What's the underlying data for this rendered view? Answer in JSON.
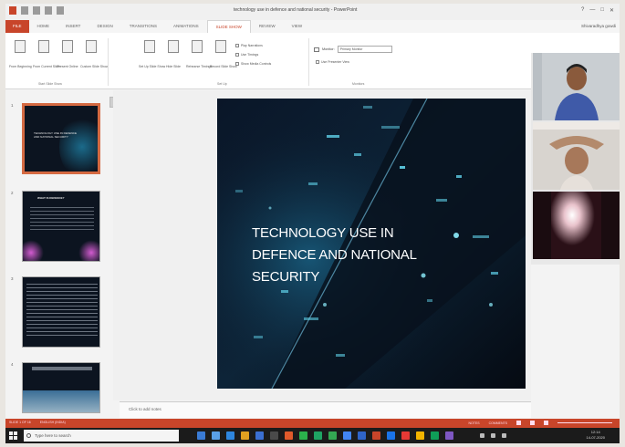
{
  "window": {
    "title": "technology use in defence and national security - PowerPoint",
    "controls": [
      "?",
      "—",
      "□",
      "✕"
    ]
  },
  "ribbon": {
    "tabs": [
      "FILE",
      "HOME",
      "INSERT",
      "DESIGN",
      "TRANSITIONS",
      "ANIMATIONS",
      "SLIDE SHOW",
      "REVIEW",
      "VIEW"
    ],
    "active_tab": "SLIDE SHOW",
    "user_name": "Shivaradhya gowdi",
    "groups": {
      "start_slide_show": {
        "label": "Start Slide Show",
        "buttons": [
          "From Beginning",
          "From Current Slide",
          "Present Online",
          "Custom Slide Show"
        ]
      },
      "set_up": {
        "label": "Set Up",
        "buttons": [
          "Set Up Slide Show",
          "Hide Slide",
          "Rehearse Timings",
          "Record Slide Show"
        ],
        "checkboxes": [
          "Play Narrations",
          "Use Timings",
          "Show Media Controls"
        ]
      },
      "monitors": {
        "label": "Monitors",
        "monitor_label": "Monitor:",
        "monitor_value": "Primary Monitor",
        "checkbox": "Use Presenter View"
      }
    }
  },
  "thumbnails": {
    "slides": [
      {
        "number": "1",
        "title": "TECHNOLOGY USE IN DEFENCE AND NATIONAL SECURITY"
      },
      {
        "number": "2",
        "title": "WHAT IS DEFENCE?"
      },
      {
        "number": "3",
        "title": ""
      },
      {
        "number": "4",
        "title": ""
      }
    ]
  },
  "slide": {
    "title_lines": [
      "TECHNOLOGY USE IN",
      "DEFENCE AND NATIONAL",
      "SECURITY"
    ]
  },
  "notes": {
    "placeholder": "Click to add notes"
  },
  "status_bar": {
    "slide_info": "SLIDE 1 OF 16",
    "language": "ENGLISH (INDIA)",
    "notes": "NOTES",
    "comments": "COMMENTS"
  },
  "taskbar": {
    "search_placeholder": "Type here to search",
    "time": "12:14",
    "date": "14-07-2020"
  },
  "colors": {
    "accent": "#c8452a",
    "slide_bg": "#0a1220",
    "taskbar": "#1b1b1b"
  }
}
